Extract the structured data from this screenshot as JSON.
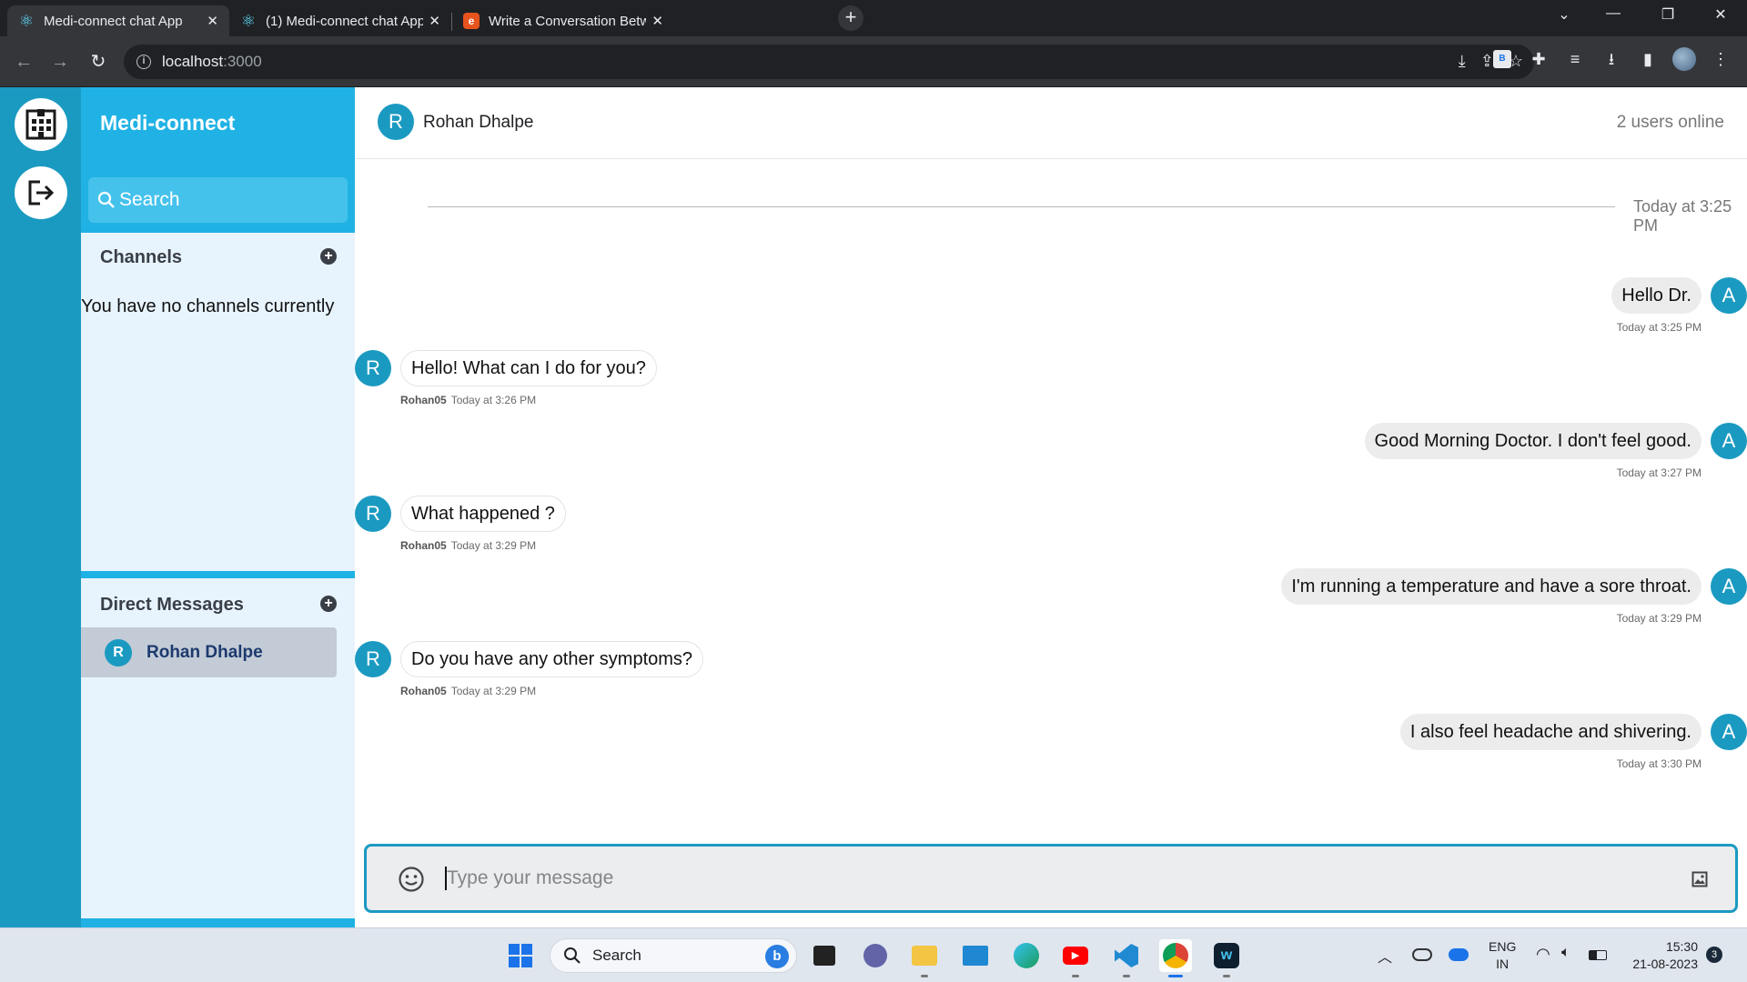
{
  "browser": {
    "tabs": [
      {
        "title": "Medi-connect chat App",
        "icon": "react-icon",
        "active": true
      },
      {
        "title": "(1) Medi-connect chat App",
        "icon": "react-icon",
        "active": false
      },
      {
        "title": "Write a Conversation Between Do",
        "icon": "blog-icon",
        "active": false
      }
    ],
    "url_host": "localhost",
    "url_port": ":3000",
    "window_controls": [
      "minimize-icon",
      "maximize-icon",
      "close-icon"
    ]
  },
  "app": {
    "brand": "Medi-connect",
    "rail": [
      "hospital-icon",
      "logout-icon"
    ],
    "search_placeholder": "Search",
    "channels": {
      "title": "Channels",
      "empty_text": "You have no channels currently"
    },
    "direct_messages": {
      "title": "Direct Messages",
      "items": [
        {
          "initial": "R",
          "name": "Rohan Dhalpe"
        }
      ]
    },
    "accent_color": "#1b9ac1"
  },
  "chat": {
    "header": {
      "initial": "R",
      "name": "Rohan Dhalpe",
      "online": "2 users online"
    },
    "date_separator": "Today at 3:25 PM",
    "messages": [
      {
        "direction": "out",
        "initial": "A",
        "text": "Hello Dr.",
        "author": "",
        "time": "Today at 3:25 PM"
      },
      {
        "direction": "in",
        "initial": "R",
        "text": "Hello! What can I do for you?",
        "author": "Rohan05",
        "time": "Today at 3:26 PM"
      },
      {
        "direction": "out",
        "initial": "A",
        "text": "Good Morning Doctor. I don't feel good.",
        "author": "",
        "time": "Today at 3:27 PM"
      },
      {
        "direction": "in",
        "initial": "R",
        "text": "What happened ?",
        "author": "Rohan05",
        "time": "Today at 3:29 PM"
      },
      {
        "direction": "out",
        "initial": "A",
        "text": "I'm running a temperature and have a sore throat.",
        "author": "",
        "time": "Today at 3:29 PM"
      },
      {
        "direction": "in",
        "initial": "R",
        "text": "Do you have any other symptoms?",
        "author": "Rohan05",
        "time": "Today at 3:29 PM"
      },
      {
        "direction": "out",
        "initial": "A",
        "text": "I also feel headache and shivering.",
        "author": "",
        "time": "Today at 3:30 PM"
      }
    ],
    "composer": {
      "placeholder": "Type your message",
      "value": ""
    }
  },
  "taskbar": {
    "search_label": "Search",
    "apps": [
      "windows-start-icon",
      "bing-icon",
      "terminal-icon",
      "teams-icon",
      "file-explorer-icon",
      "remote-desktop-icon",
      "edge-icon",
      "youtube-icon",
      "vscode-icon",
      "chrome-icon",
      "webex-icon"
    ],
    "lang_primary": "ENG",
    "lang_secondary": "IN",
    "time": "15:30",
    "date": "21-08-2023",
    "notifications": "3"
  }
}
